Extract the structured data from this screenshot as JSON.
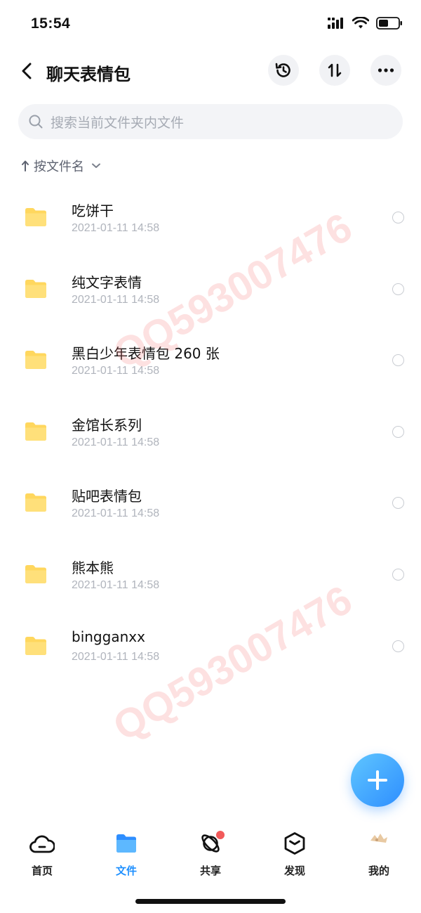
{
  "status_bar": {
    "time": "15:54",
    "icons": [
      "signal-icon",
      "wifi-icon",
      "battery-icon"
    ],
    "battery_level": 0.5
  },
  "nav": {
    "title": "聊天表情包",
    "actions": [
      "history-icon",
      "transfer-icon",
      "more-icon"
    ]
  },
  "search": {
    "placeholder": "搜索当前文件夹内文件"
  },
  "sort": {
    "label": "按文件名"
  },
  "files": [
    {
      "name": "吃饼干",
      "date": "2021-01-11  14:58"
    },
    {
      "name": "纯文字表情",
      "date": "2021-01-11  14:58"
    },
    {
      "name": "黑白少年表情包 260 张",
      "date": "2021-01-11  14:58"
    },
    {
      "name": "金馆长系列",
      "date": "2021-01-11  14:58"
    },
    {
      "name": "贴吧表情包",
      "date": "2021-01-11  14:58"
    },
    {
      "name": "熊本熊",
      "date": "2021-01-11  14:58"
    },
    {
      "name": "bingganxx",
      "date": "2021-01-11  14:58"
    }
  ],
  "watermark": {
    "text": "QQ593007476"
  },
  "tabs": [
    {
      "label": "首页",
      "icon": "home-cloud-icon",
      "active": false
    },
    {
      "label": "文件",
      "icon": "folder-icon",
      "active": true
    },
    {
      "label": "共享",
      "icon": "share-orbit-icon",
      "active": false,
      "badge": true
    },
    {
      "label": "发现",
      "icon": "discover-box-icon",
      "active": false
    },
    {
      "label": "我的",
      "icon": "avatar-icon",
      "active": false
    }
  ],
  "colors": {
    "accent": "#1e90ff",
    "folder": "#ffd75e",
    "badge": "#f25a5a",
    "watermark": "#f47878"
  }
}
